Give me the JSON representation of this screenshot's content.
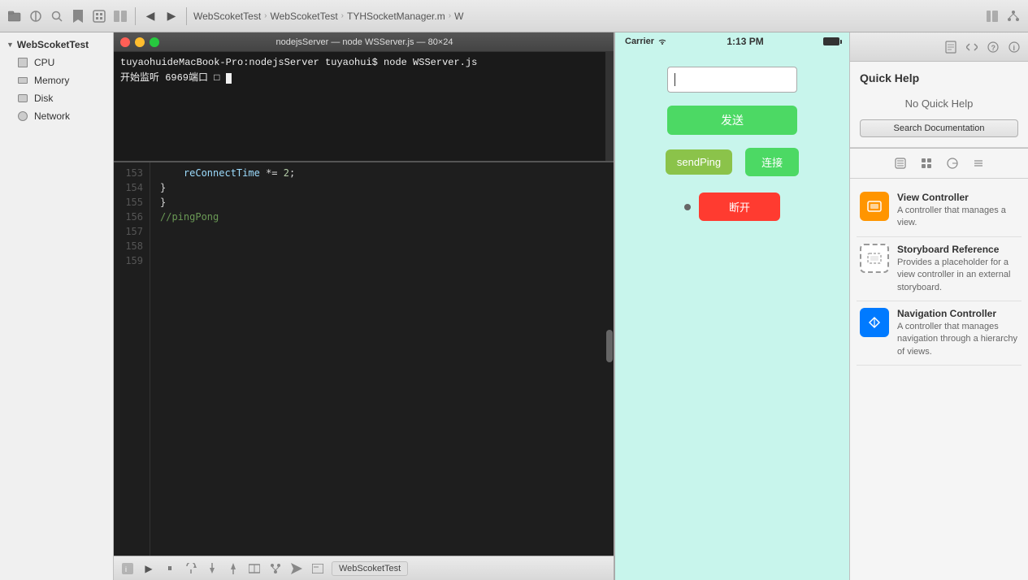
{
  "window": {
    "title": "WebScoketTest"
  },
  "toolbar": {
    "breadcrumbs": [
      "WebScoketTest",
      "WebScoketTest",
      "TYHSocketManager.m",
      "W"
    ],
    "terminal_title": "nodejsServer — node WSServer.js — 80×24"
  },
  "sidebar": {
    "section_label": "WebScoketTest",
    "items": [
      {
        "id": "cpu",
        "label": "CPU"
      },
      {
        "id": "memory",
        "label": "Memory"
      },
      {
        "id": "disk",
        "label": "Disk"
      },
      {
        "id": "network",
        "label": "Network"
      }
    ]
  },
  "terminal": {
    "line1": "tuyaohuideMacBook-Pro:nodejsServer tuyaohui$ node WSServer.js",
    "line2": "开始监听 6969端口 □"
  },
  "code_editor": {
    "lines": [
      {
        "num": "153",
        "content": "    reConnectTime *= 2;"
      },
      {
        "num": "154",
        "content": "}"
      },
      {
        "num": "155",
        "content": ""
      },
      {
        "num": "156",
        "content": "}"
      },
      {
        "num": "157",
        "content": ""
      },
      {
        "num": "158",
        "content": ""
      },
      {
        "num": "159",
        "content": "//pingPong"
      }
    ]
  },
  "bottom_toolbar": {
    "label": "WebScoketTest"
  },
  "simulator": {
    "carrier": "Carrier",
    "time": "1:13 PM",
    "input_placeholder": "",
    "btn_send_label": "发送",
    "btn_send_ping_label": "sendPing",
    "btn_connect_label": "连接",
    "btn_disconnect_label": "断开"
  },
  "right_panel": {
    "section_title": "Quick Help",
    "no_help_text": "No Quick Help",
    "search_doc_btn": "Search Documentation",
    "objects": [
      {
        "id": "view-controller",
        "name": "View Controller",
        "desc": "A controller that manages a view.",
        "icon_type": "vc"
      },
      {
        "id": "storyboard-reference",
        "name": "Storyboard Reference",
        "desc": "Provides a placeholder for a view controller in an external storyboard.",
        "icon_type": "sb-ref"
      },
      {
        "id": "navigation-controller",
        "name": "Navigation Controller",
        "desc": "A controller that manages navigation through a hierarchy of views.",
        "icon_type": "nav"
      }
    ]
  },
  "icons": {
    "close": "✕",
    "minimize": "−",
    "maximize": "+",
    "triangle_right": "▶",
    "triangle_down": "▼",
    "chevron_left": "‹",
    "chevron_right": "›",
    "folder": "📁",
    "arrow_left": "←",
    "arrow_right": "→",
    "play": "▶",
    "pause": "⏸",
    "step_over": "↷",
    "step_in": "↓",
    "step_out": "↑",
    "debug": "⚙",
    "terminal": "⌘",
    "page": "📄",
    "question": "?",
    "info": "ℹ",
    "gear": "⚙",
    "back": "◀",
    "forward": "▶"
  }
}
